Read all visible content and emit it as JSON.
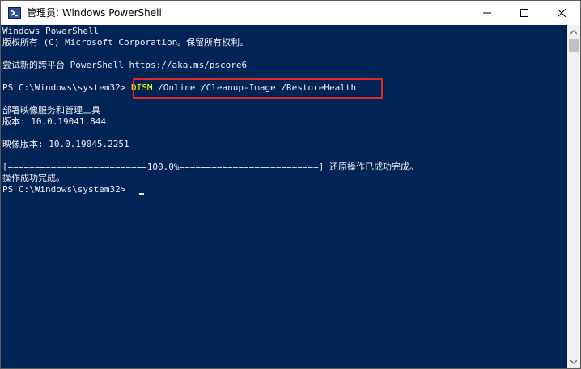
{
  "window": {
    "title": "管理员: Windows PowerShell",
    "app_icon": "powershell-icon",
    "caption_buttons": {
      "minimize": "─",
      "maximize": "☐",
      "close": "✕"
    }
  },
  "console": {
    "lines": [
      "Windows PowerShell",
      "版权所有 (C) Microsoft Corporation。保留所有权利。",
      "",
      "尝试新的跨平台 PowerShell https://aka.ms/pscore6",
      "",
      "",
      "",
      "部署映像服务和管理工具",
      "版本: 10.0.19041.844",
      "",
      "映像版本: 10.0.19045.2251",
      "",
      "[==========================100.0%==========================] 还原操作已成功完成。",
      "操作成功完成。"
    ],
    "prompt_line": {
      "prompt": "PS C:\\Windows\\system32> ",
      "command_keyword": "DISM",
      "command_args": " /Online /Cleanup-Image /RestoreHealth"
    },
    "final_prompt": "PS C:\\Windows\\system32> "
  },
  "colors": {
    "background": "#012456",
    "text": "#eeedf0",
    "command_keyword": "#ffff00",
    "highlight_border": "#e0282a"
  }
}
